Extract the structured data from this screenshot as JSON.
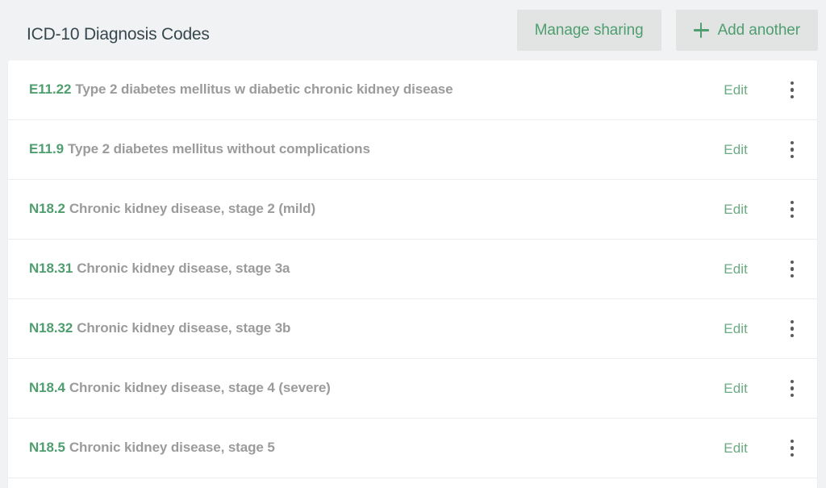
{
  "header": {
    "title": "ICD-10 Diagnosis Codes",
    "manage_sharing_label": "Manage sharing",
    "add_another_label": "Add another",
    "add_icon": "plus-icon"
  },
  "colors": {
    "page_background": "#f1f2f4",
    "card_background": "#ffffff",
    "accent_green": "#4f9e70",
    "edit_green": "#6aab82",
    "description_gray": "#9b9b9b",
    "title_slate": "#36474e",
    "button_background": "#e1e4e2",
    "row_divider": "#ebedef",
    "kebab_dot": "#5c5c5c"
  },
  "list": {
    "row_action_edit_label": "Edit",
    "row_menu_icon": "kebab-menu-icon",
    "rows": [
      {
        "code": "E11.22",
        "description": "Type 2 diabetes mellitus w diabetic chronic kidney disease"
      },
      {
        "code": "E11.9",
        "description": "Type 2 diabetes mellitus without complications"
      },
      {
        "code": "N18.2",
        "description": "Chronic kidney disease, stage 2 (mild)"
      },
      {
        "code": "N18.31",
        "description": "Chronic kidney disease, stage 3a"
      },
      {
        "code": "N18.32",
        "description": "Chronic kidney disease, stage 3b"
      },
      {
        "code": "N18.4",
        "description": "Chronic kidney disease, stage 4 (severe)"
      },
      {
        "code": "N18.5",
        "description": "Chronic kidney disease, stage 5"
      }
    ]
  }
}
